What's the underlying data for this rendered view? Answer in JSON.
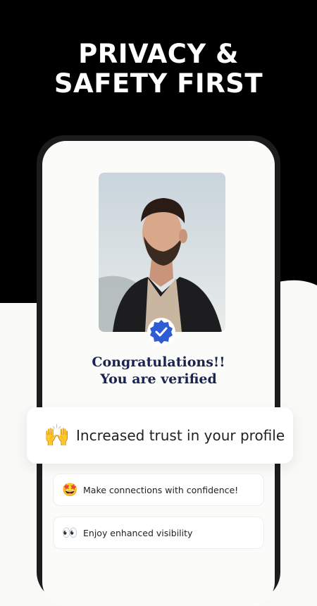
{
  "headline": {
    "line1": "PRIVACY &",
    "line2": "SAFETY FIRST"
  },
  "profile": {
    "verified_icon": "check-badge-icon",
    "message_line1": "Congratulations!!",
    "message_line2": "You are verified"
  },
  "benefits": {
    "primary": {
      "emoji": "🙌",
      "text": "Increased trust in your profile"
    },
    "items": [
      {
        "emoji": "🤩",
        "text": "Make connections with confidence!"
      },
      {
        "emoji": "👀",
        "text": "Enjoy enhanced visibility"
      }
    ]
  },
  "colors": {
    "hero_background": "#000000",
    "page_background": "#f9f9f7",
    "badge_blue": "#2f5bd3",
    "heading_navy": "#1a2350"
  }
}
